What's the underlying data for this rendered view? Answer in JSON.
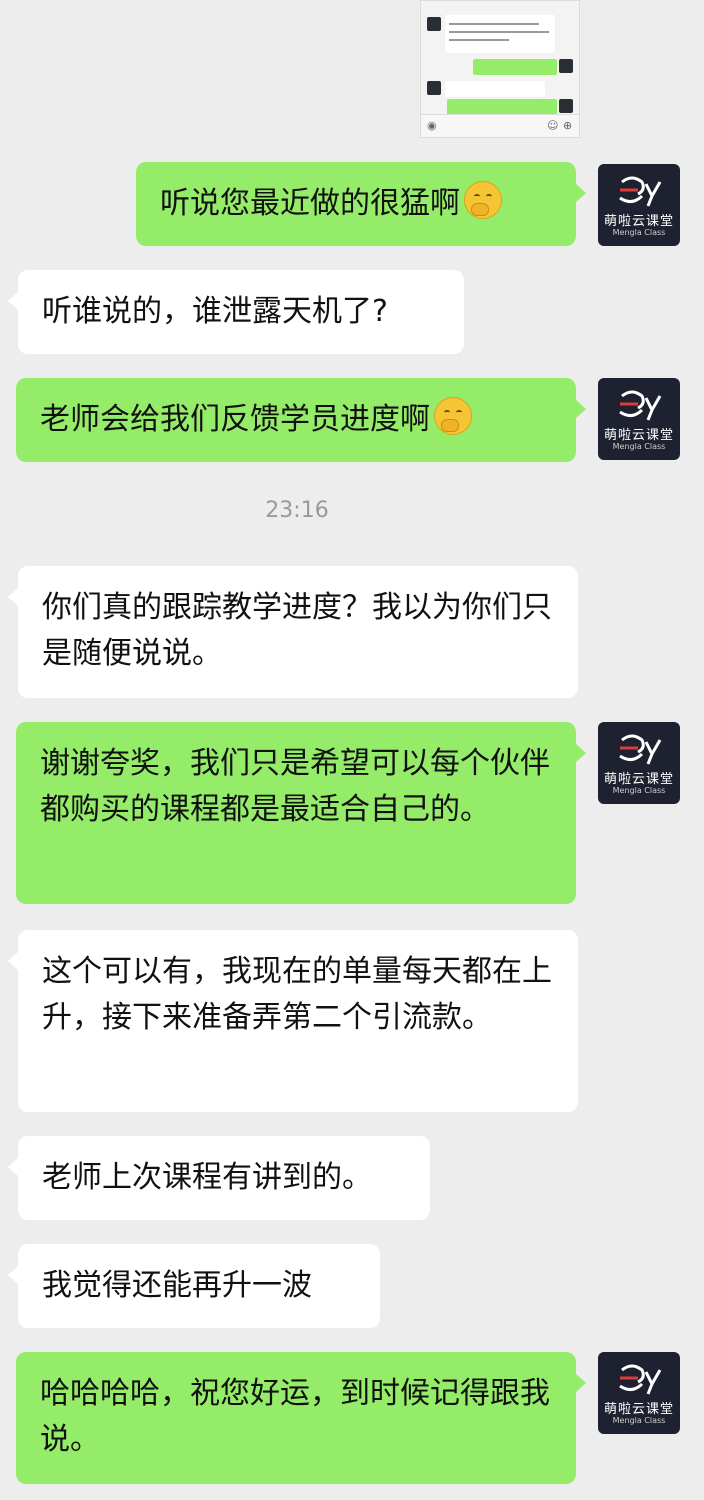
{
  "timestamp": "23:16",
  "avatar": {
    "brand": "萌啦云课堂",
    "brand_sub": "Mengla Class"
  },
  "messages": [
    {
      "side": "out",
      "text": "听说您最近做的很猛啊",
      "emoji": "thinking-face-emoji"
    },
    {
      "side": "in",
      "text": "听谁说的，谁泄露天机了?"
    },
    {
      "side": "out",
      "text": "老师会给我们反馈学员进度啊",
      "emoji": "thinking-face-emoji"
    },
    {
      "side": "in",
      "text": "你们真的跟踪教学进度？我以为你们只是随便说说。"
    },
    {
      "side": "out",
      "text": "谢谢夸奖，我们只是希望可以每个伙伴都购买的课程都是最适合自己的。"
    },
    {
      "side": "in",
      "text": "这个可以有，我现在的单量每天都在上升，接下来准备弄第二个引流款。"
    },
    {
      "side": "in",
      "text": "老师上次课程有讲到的。"
    },
    {
      "side": "in",
      "text": "我觉得还能再升一波"
    },
    {
      "side": "out",
      "text": "哈哈哈哈，祝您好运，到时候记得跟我说。"
    }
  ],
  "colors": {
    "background": "#ededed",
    "outgoing_bubble": "#95ec69",
    "incoming_bubble": "#ffffff",
    "avatar_bg": "#1e2230"
  }
}
